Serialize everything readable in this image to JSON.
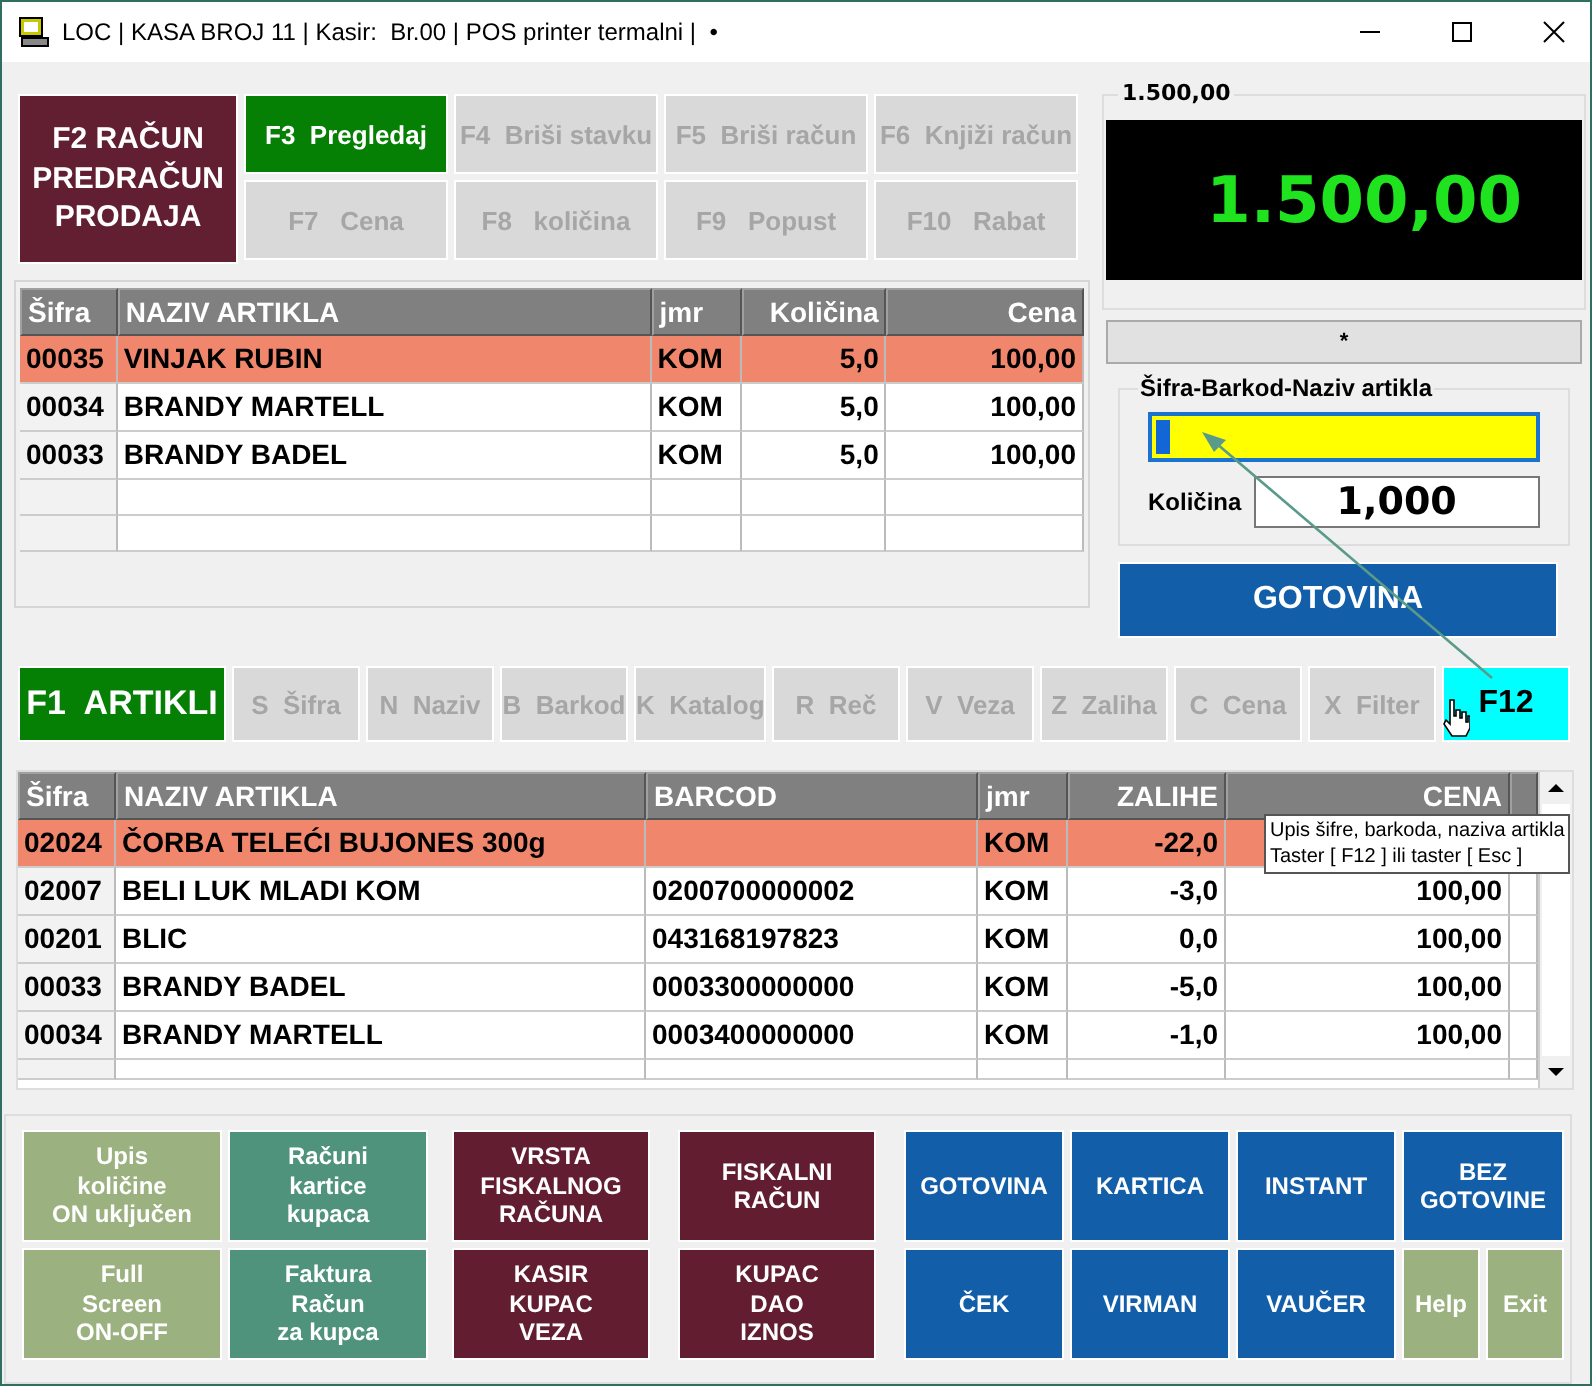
{
  "window": {
    "title": "LOC | KASA BROJ 11 | Kasir:  Br.00 | POS printer termalni |  •"
  },
  "mode_button": {
    "label": "F2 RAČUN PREDRAČUN PRODAJA"
  },
  "function_keys": [
    {
      "label": "F3  Pregledaj",
      "disabled": false
    },
    {
      "label": "F4  Briši stavku",
      "disabled": true
    },
    {
      "label": "F5  Briši račun",
      "disabled": true
    },
    {
      "label": "F6  Knjiži račun",
      "disabled": true
    },
    {
      "label": "F7   Cena",
      "disabled": true
    },
    {
      "label": "F8   količina",
      "disabled": true
    },
    {
      "label": "F9   Popust",
      "disabled": true
    },
    {
      "label": "F10   Rabat",
      "disabled": true
    }
  ],
  "cart": {
    "columns": [
      "Šifra",
      "NAZIV ARTIKLA",
      "jmr",
      "Količina",
      "Cena"
    ],
    "rows": [
      {
        "cells": [
          "00035",
          "VINJAK RUBIN",
          "KOM",
          "5,0",
          "100,00"
        ],
        "selected": true
      },
      {
        "cells": [
          "00034",
          "BRANDY MARTELL",
          "KOM",
          "5,0",
          "100,00"
        ],
        "selected": false
      },
      {
        "cells": [
          "00033",
          "BRANDY BADEL",
          "KOM",
          "5,0",
          "100,00"
        ],
        "selected": false
      }
    ]
  },
  "total": {
    "caption": "1.500,00",
    "amount": "1.500,00"
  },
  "status_strip": "*",
  "entry": {
    "group_label": "Šifra-Barkod-Naziv artikla",
    "quantity_label": "Količina",
    "quantity": "1,000"
  },
  "pay_button": "GOTOVINA",
  "article_tabs": [
    {
      "label": "F1  ARTIKLI",
      "kind": "main"
    },
    {
      "label": "S  Šifra",
      "kind": "off"
    },
    {
      "label": "N  Naziv",
      "kind": "off"
    },
    {
      "label": "B  Barkod",
      "kind": "off"
    },
    {
      "label": "K  Katalog",
      "kind": "off"
    },
    {
      "label": "R  Reč",
      "kind": "off"
    },
    {
      "label": "V  Veza",
      "kind": "off"
    },
    {
      "label": "Z  Zaliha",
      "kind": "off"
    },
    {
      "label": "C  Cena",
      "kind": "off"
    },
    {
      "label": "X  Filter",
      "kind": "off"
    },
    {
      "label": "F12",
      "kind": "highlight"
    }
  ],
  "articles": {
    "columns": [
      "Šifra",
      "NAZIV ARTIKLA",
      "BARCOD",
      "jmr",
      "ZALIHE",
      "CENA"
    ],
    "rows": [
      {
        "cells": [
          "02024",
          "ČORBA TELEĆI BUJONES 300g",
          "",
          "KOM",
          "-22,0",
          ""
        ],
        "selected": true
      },
      {
        "cells": [
          "02007",
          "BELI LUK MLADI KOM",
          "0200700000002",
          "KOM",
          "-3,0",
          "100,00"
        ],
        "selected": false
      },
      {
        "cells": [
          "00201",
          "BLIC",
          "043168197823",
          "KOM",
          "0,0",
          "100,00"
        ],
        "selected": false
      },
      {
        "cells": [
          "00033",
          "BRANDY BADEL",
          "0003300000000",
          "KOM",
          "-5,0",
          "100,00"
        ],
        "selected": false
      },
      {
        "cells": [
          "00034",
          "BRANDY MARTELL",
          "0003400000000",
          "KOM",
          "-1,0",
          "100,00"
        ],
        "selected": false
      }
    ]
  },
  "tooltip": [
    "Upis šifre, barkoda, naziva artikla",
    "Taster [ F12 ] ili taster [ Esc ]"
  ],
  "action_buttons": [
    {
      "lines": [
        "Upis",
        "količine",
        "ON uključen"
      ],
      "color": "#9bb17f"
    },
    {
      "lines": [
        "Računi",
        "kartice",
        "kupaca"
      ],
      "color": "#4f937c"
    },
    {
      "lines": [
        "VRSTA",
        "FISKALNOG",
        "RAČUNA"
      ],
      "color": "#621e30"
    },
    {
      "lines": [
        "FISKALNI",
        "RAČUN"
      ],
      "color": "#621e30"
    },
    {
      "lines": [
        "GOTOVINA"
      ],
      "color": "#125ea8"
    },
    {
      "lines": [
        "KARTICA"
      ],
      "color": "#125ea8"
    },
    {
      "lines": [
        "INSTANT"
      ],
      "color": "#125ea8"
    },
    {
      "lines": [
        "BEZ",
        "GOTOVINE"
      ],
      "color": "#125ea8"
    },
    {
      "lines": [
        "Full",
        "Screen",
        "ON-OFF"
      ],
      "color": "#9bb17f"
    },
    {
      "lines": [
        "Faktura",
        "Račun",
        "za kupca"
      ],
      "color": "#4f937c"
    },
    {
      "lines": [
        "KASIR",
        "KUPAC",
        "VEZA"
      ],
      "color": "#621e30"
    },
    {
      "lines": [
        "KUPAC",
        "DAO",
        "IZNOS"
      ],
      "color": "#621e30"
    },
    {
      "lines": [
        "ČEK"
      ],
      "color": "#125ea8"
    },
    {
      "lines": [
        "VIRMAN"
      ],
      "color": "#125ea8"
    },
    {
      "lines": [
        "VAUČER"
      ],
      "color": "#125ea8"
    },
    {
      "lines": [
        "Help"
      ],
      "color": "#9bb17f"
    },
    {
      "lines": [
        "Exit"
      ],
      "color": "#9bb17f"
    }
  ]
}
